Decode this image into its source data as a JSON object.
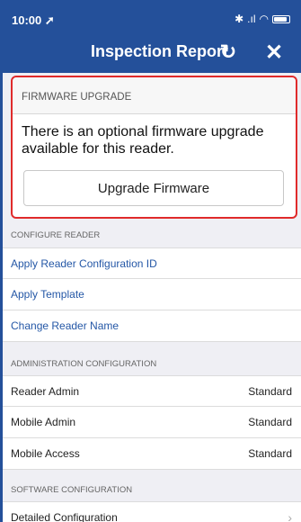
{
  "status_bar": {
    "time": "10:00",
    "signal": ".ıl"
  },
  "header": {
    "title": "Inspection Report"
  },
  "firmware": {
    "section_title": "FIRMWARE UPGRADE",
    "message": "There is an optional firmware upgrade available for this reader.",
    "button_label": "Upgrade Firmware"
  },
  "configure_reader": {
    "section_title": "CONFIGURE READER",
    "items": [
      {
        "label": "Apply Reader Configuration ID"
      },
      {
        "label": "Apply Template"
      },
      {
        "label": "Change Reader Name"
      }
    ]
  },
  "administration": {
    "section_title": "ADMINISTRATION CONFIGURATION",
    "items": [
      {
        "label": "Reader Admin",
        "value": "Standard"
      },
      {
        "label": "Mobile Admin",
        "value": "Standard"
      },
      {
        "label": "Mobile Access",
        "value": "Standard"
      }
    ]
  },
  "software": {
    "section_title": "SOFTWARE CONFIGURATION",
    "items": [
      {
        "label": "Detailed Configuration"
      }
    ]
  },
  "colors": {
    "header_bg": "#24509a",
    "link": "#2457a6",
    "highlight": "#e02b2b"
  }
}
